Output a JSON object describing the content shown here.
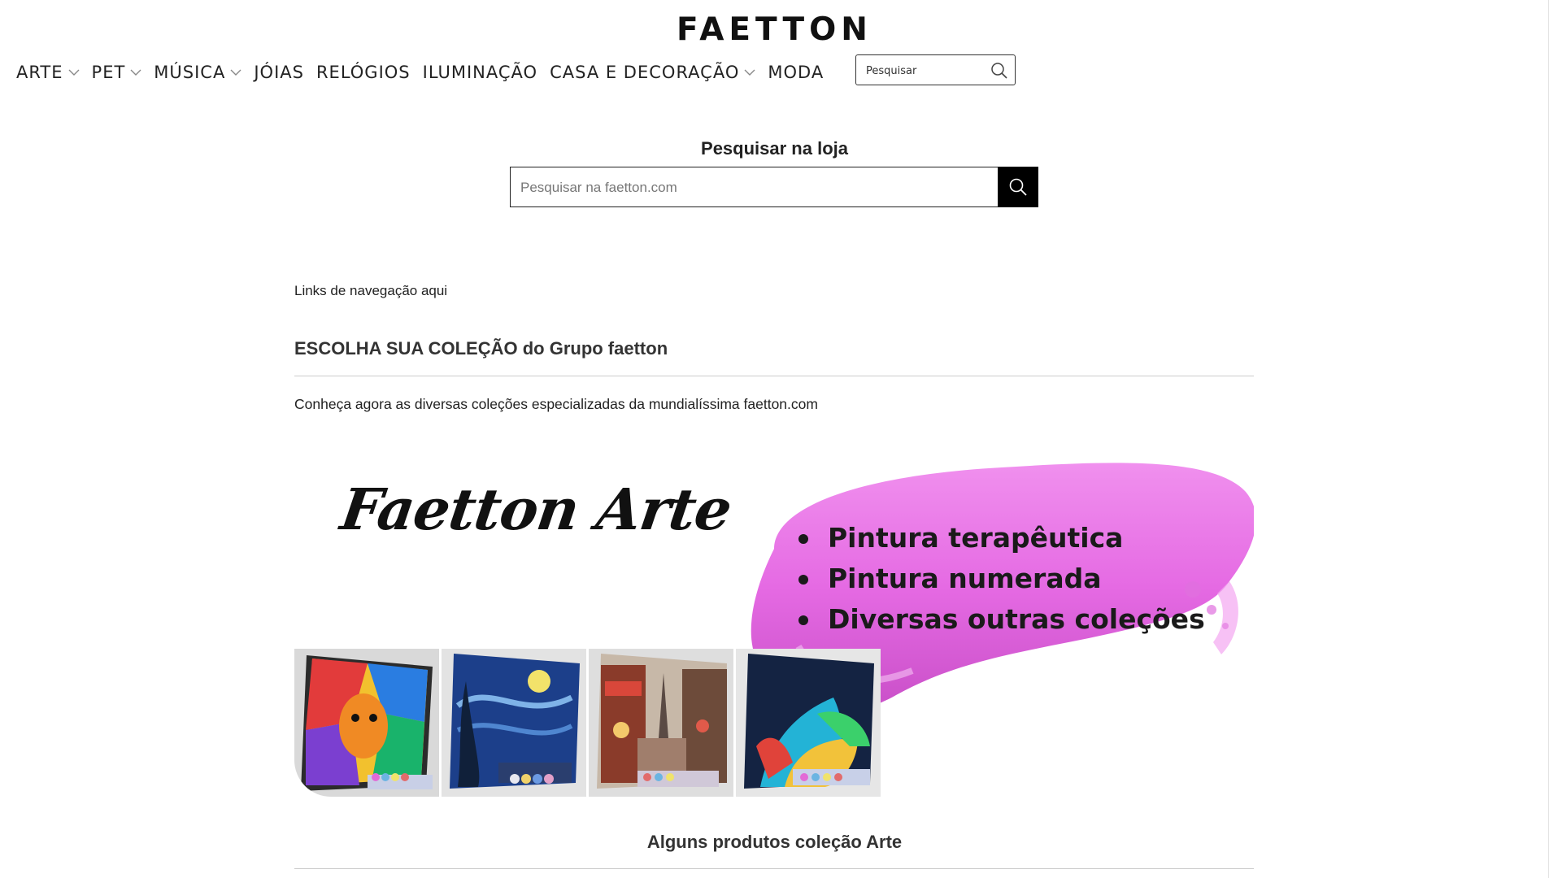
{
  "header": {
    "logo": "FAETTON",
    "nav": [
      {
        "label": "ARTE",
        "dropdown": true
      },
      {
        "label": "PET",
        "dropdown": true
      },
      {
        "label": "MÚSICA",
        "dropdown": true
      },
      {
        "label": "JÓIAS",
        "dropdown": false
      },
      {
        "label": "RELÓGIOS",
        "dropdown": false
      },
      {
        "label": "ILUMINAÇÃO",
        "dropdown": false
      },
      {
        "label": "CASA E DECORAÇÃO",
        "dropdown": true
      },
      {
        "label": "MODA",
        "dropdown": false
      }
    ],
    "search_placeholder": "Pesquisar"
  },
  "search": {
    "title": "Pesquisar na loja",
    "placeholder": "Pesquisar na faetton.com"
  },
  "content": {
    "breadcrumb": "Links de navegação aqui",
    "collection_title": "ESCOLHA SUA COLEÇÃO do Grupo faetton",
    "collection_description": "Conheça agora as diversas coleções especializadas da mundialíssima faetton.com",
    "banner": {
      "brand": "Faetton Arte",
      "features": [
        "Pintura terapêutica",
        "Pintura numerada",
        "Diversas outras coleções"
      ],
      "thumbnails": [
        "lion-painting",
        "starry-night-painting",
        "paris-street-painting",
        "parrot-painting"
      ]
    },
    "section_title": "Alguns produtos coleção Arte"
  },
  "colors": {
    "accent_brush": "#e76ae6",
    "text": "#222222",
    "button_bg": "#000000"
  }
}
